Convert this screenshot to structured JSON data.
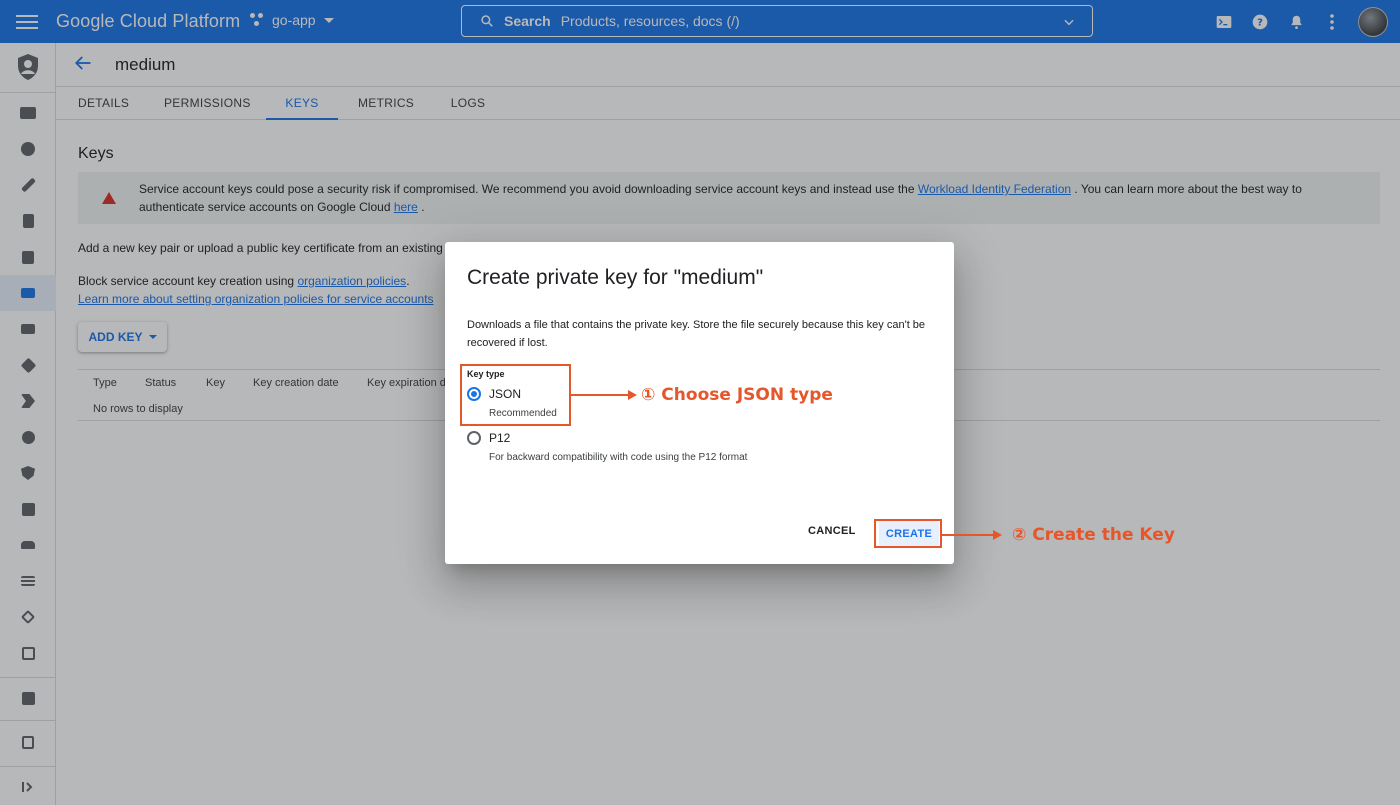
{
  "topbar": {
    "brand": "Google Cloud Platform",
    "project": "go-app",
    "search_label": "Search",
    "search_hint": "Products, resources, docs (/)",
    "icons": [
      "cloud-shell-icon",
      "help-icon",
      "notifications-icon",
      "more-vert-icon"
    ],
    "accent_color": "#1a73e8"
  },
  "rail": {
    "items": [
      "iam-add-icon",
      "account-icon",
      "wrench-icon",
      "audit-icon",
      "log-icon",
      "service-accounts-icon",
      "workload-icon",
      "labels-icon",
      "tags-icon",
      "settings-icon",
      "privacy-icon",
      "identity-icon",
      "groups-icon",
      "roles-icon",
      "org-policies-icon",
      "asset-icon",
      "quotas-icon",
      "manage-resources-icon",
      "release-notes-icon",
      "collapse-icon"
    ]
  },
  "header": {
    "title": "medium",
    "tabs": [
      {
        "label": "DETAILS"
      },
      {
        "label": "PERMISSIONS"
      },
      {
        "label": "KEYS"
      },
      {
        "label": "METRICS"
      },
      {
        "label": "LOGS"
      }
    ]
  },
  "content": {
    "heading": "Keys",
    "alert": {
      "text_before": "Service account keys could pose a security risk if compromised. We recommend you avoid downloading service account keys and instead use the ",
      "link1": "Workload Identity Federation",
      "text_middle": " . You can learn more about the best way to authenticate service accounts on Google Cloud ",
      "link2": "here",
      "text_after": " ."
    },
    "add_pair_text": "Add a new key pair or upload a public key certificate from an existing k",
    "block_text": "Block service account key creation using ",
    "block_link": "organization policies",
    "block_after": ".",
    "learn_link": "Learn more about setting organization policies for service accounts",
    "add_key_label": "ADD KEY",
    "table": {
      "columns": [
        "Type",
        "Status",
        "Key",
        "Key creation date",
        "Key expiration d"
      ],
      "empty": "No rows to display"
    }
  },
  "dialog": {
    "title": "Create private key for \"medium\"",
    "description": "Downloads a file that contains the private key. Store the file securely because this key can't be recovered if lost.",
    "key_type_label": "Key type",
    "options": [
      {
        "label": "JSON",
        "sub": "Recommended",
        "selected": true
      },
      {
        "label": "P12",
        "sub": "For backward compatibility with code using the P12 format",
        "selected": false
      }
    ],
    "cancel_label": "CANCEL",
    "create_label": "CREATE"
  },
  "annotations": {
    "step1": "① Choose JSON type",
    "step2": "② Create the Key",
    "color": "#e5562a"
  }
}
